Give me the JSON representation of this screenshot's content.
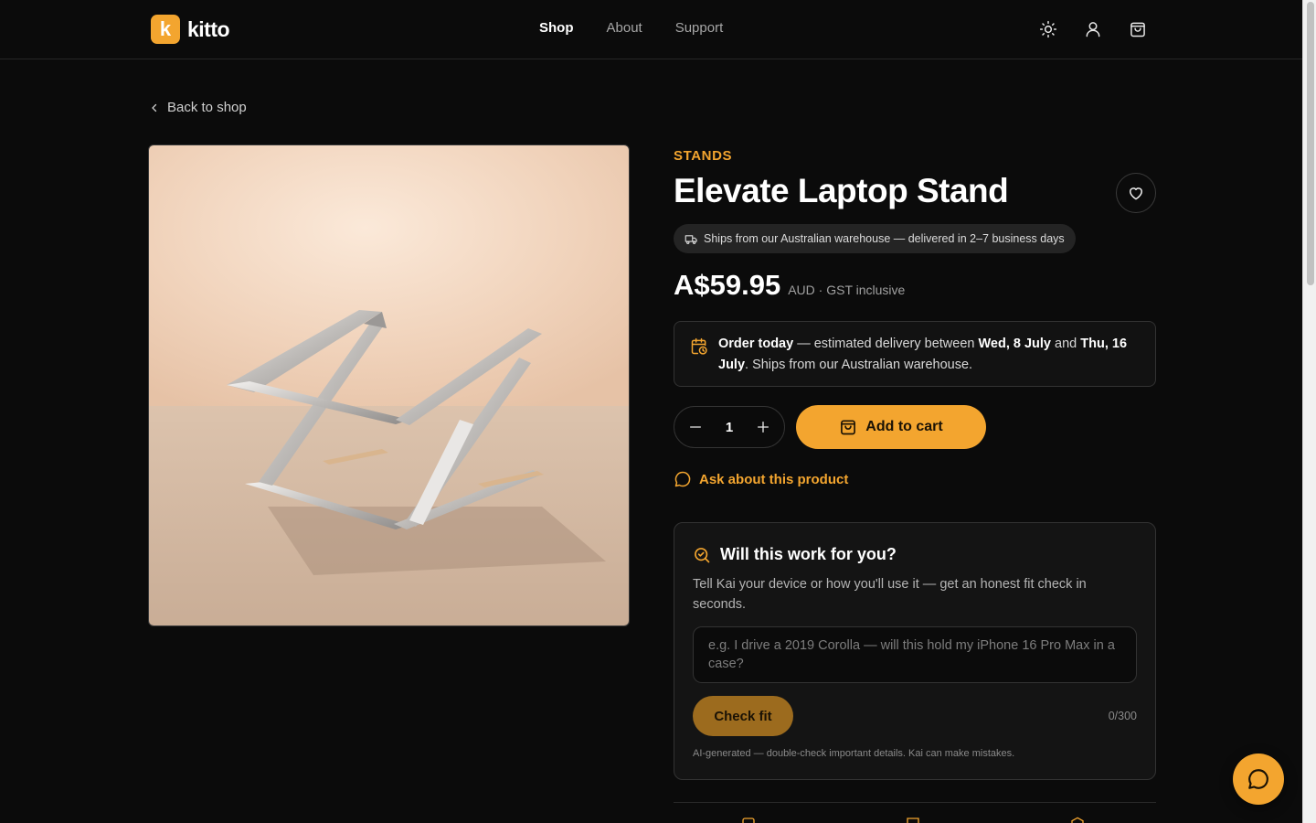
{
  "brand": {
    "logo_letter": "k",
    "name": "kitto",
    "accent": "#f3a52f"
  },
  "nav": {
    "items": [
      "Shop",
      "About",
      "Support"
    ],
    "active": "Shop"
  },
  "header_icons": [
    "sun-icon",
    "user-icon",
    "shopping-bag-icon"
  ],
  "back_link": {
    "label": "Back to shop"
  },
  "product": {
    "category": "STANDS",
    "title": "Elevate Laptop Stand",
    "shipping_pill": "Ships from our Australian warehouse — delivered in 2–7 business days",
    "price": "A$59.95",
    "price_note": "AUD · GST inclusive",
    "image_alt": "Aluminium laptop stand on a table"
  },
  "delivery": {
    "lead": "Order today",
    "mid": " — estimated delivery between ",
    "date_from": "Wed, 8 July",
    "and": " and ",
    "date_to": "Thu, 16 July",
    "tail": ". Ships from our Australian warehouse."
  },
  "purchase": {
    "quantity": "1",
    "add_to_cart_label": "Add to cart"
  },
  "ask": {
    "label": "Ask about this product"
  },
  "fit_check": {
    "title": "Will this work for you?",
    "description": "Tell Kai your device or how you'll use it — get an honest fit check in seconds.",
    "input_value": "",
    "input_placeholder": "e.g. I drive a 2019 Corolla — will this hold my iPhone 16 Pro Max in a case?",
    "button_label": "Check fit",
    "counter": "0/300",
    "disclaimer": "AI-generated — double-check important details. Kai can make mistakes."
  }
}
